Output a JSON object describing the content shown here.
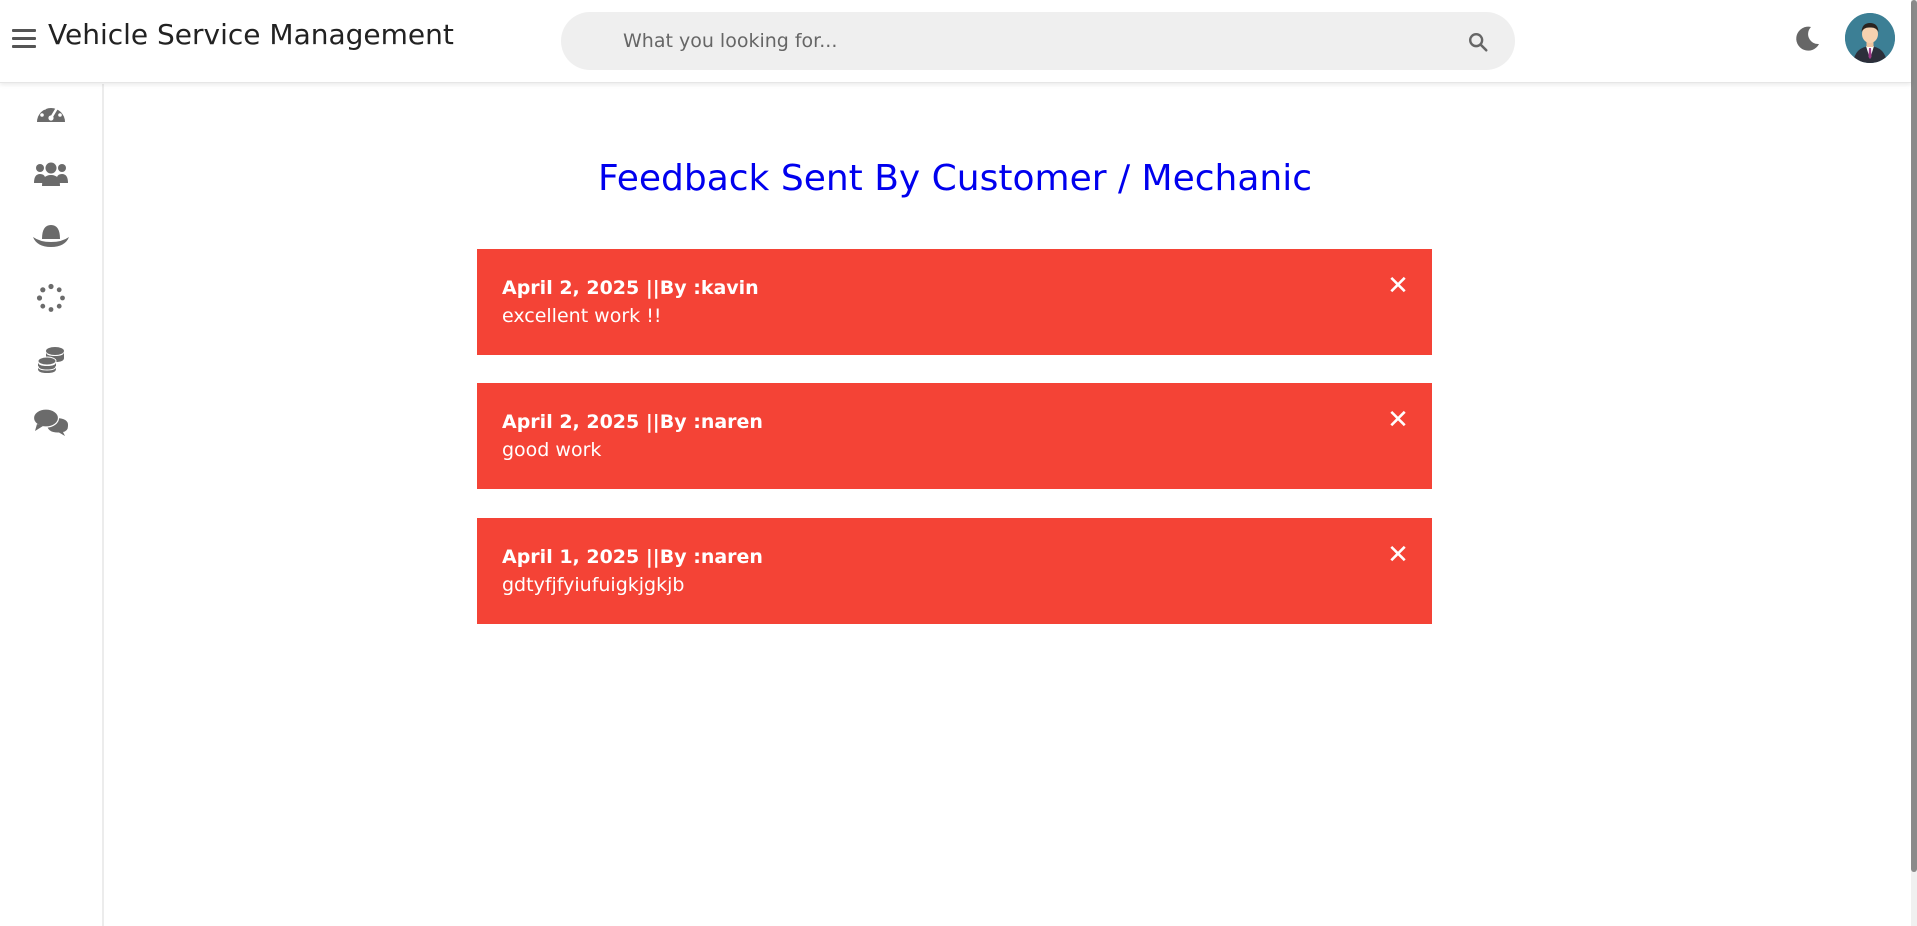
{
  "app": {
    "title": "Vehicle Service Management"
  },
  "search": {
    "placeholder": "What you looking for..."
  },
  "sidebar": {
    "items": [
      {
        "icon": "dashboard-gauge-icon"
      },
      {
        "icon": "users-icon"
      },
      {
        "icon": "mechanic-hat-icon"
      },
      {
        "icon": "spinner-dots-icon"
      },
      {
        "icon": "coins-icon"
      },
      {
        "icon": "chat-bubbles-icon"
      }
    ]
  },
  "page": {
    "title": "Feedback Sent By Customer / Mechanic"
  },
  "feedbacks": [
    {
      "header": "April 2, 2025 ||By :kavin",
      "message": "excellent work !!",
      "close": "✕"
    },
    {
      "header": "April 2, 2025 ||By :naren",
      "message": "good work",
      "close": "✕"
    },
    {
      "header": "April 1, 2025 ||By :naren",
      "message": "gdtyfjfyiufuigkjgkjb",
      "close": "✕"
    }
  ],
  "colors": {
    "card_bg": "#f44336",
    "title": "#0000ee",
    "icon_gray": "#6b6b6b"
  }
}
